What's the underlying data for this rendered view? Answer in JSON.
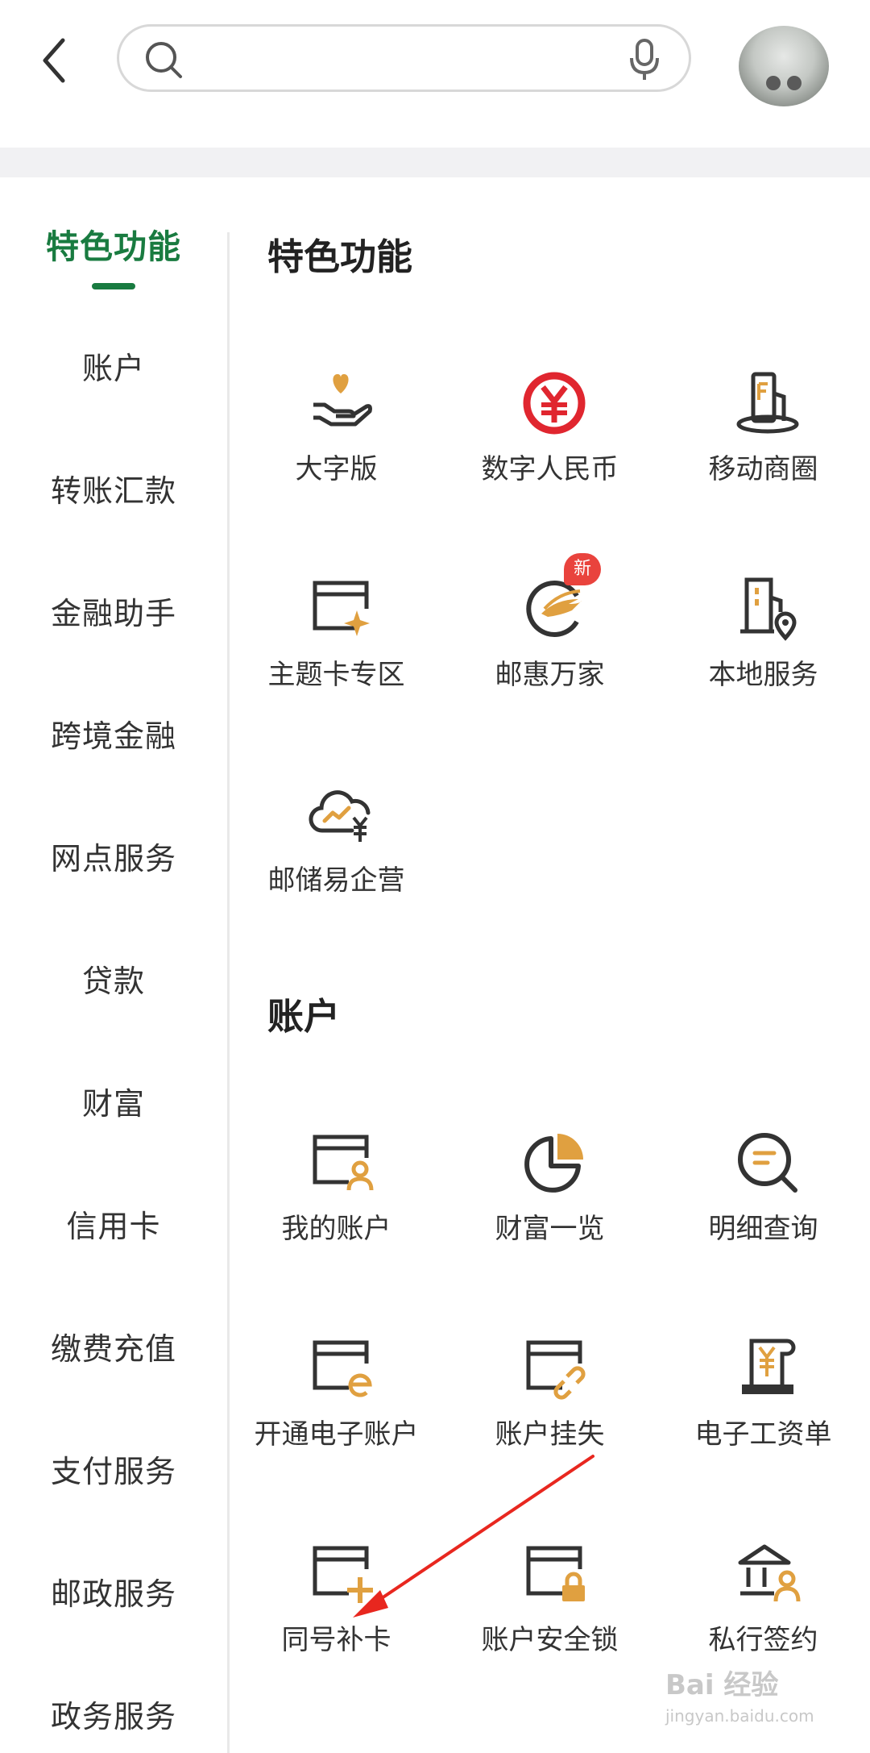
{
  "search": {
    "value": "",
    "placeholder": ""
  },
  "sidebar": {
    "items": [
      {
        "label": "特色功能"
      },
      {
        "label": "账户"
      },
      {
        "label": "转账汇款"
      },
      {
        "label": "金融助手"
      },
      {
        "label": "跨境金融"
      },
      {
        "label": "网点服务"
      },
      {
        "label": "贷款"
      },
      {
        "label": "财富"
      },
      {
        "label": "信用卡"
      },
      {
        "label": "缴费充值"
      },
      {
        "label": "支付服务"
      },
      {
        "label": "邮政服务"
      },
      {
        "label": "政务服务"
      }
    ]
  },
  "sections": [
    {
      "title": "特色功能",
      "items": [
        {
          "label": "大字版",
          "icon": "hand-heart-icon"
        },
        {
          "label": "数字人民币",
          "icon": "digital-rmb-icon"
        },
        {
          "label": "移动商圈",
          "icon": "mobile-mall-icon"
        },
        {
          "label": "主题卡专区",
          "icon": "theme-card-icon"
        },
        {
          "label": "邮惠万家",
          "icon": "postal-benefit-icon",
          "badge": "新"
        },
        {
          "label": "本地服务",
          "icon": "local-service-icon"
        },
        {
          "label": "邮储易企营",
          "icon": "cloud-enterprise-icon"
        }
      ]
    },
    {
      "title": "账户",
      "items": [
        {
          "label": "我的账户",
          "icon": "my-account-icon"
        },
        {
          "label": "财富一览",
          "icon": "pie-chart-icon"
        },
        {
          "label": "明细查询",
          "icon": "detail-search-icon"
        },
        {
          "label": "开通电子账户",
          "icon": "e-account-icon"
        },
        {
          "label": "账户挂失",
          "icon": "report-loss-icon"
        },
        {
          "label": "电子工资单",
          "icon": "payslip-icon"
        },
        {
          "label": "同号补卡",
          "icon": "card-replace-icon"
        },
        {
          "label": "账户安全锁",
          "icon": "account-lock-icon"
        },
        {
          "label": "私行签约",
          "icon": "private-bank-icon"
        }
      ]
    }
  ],
  "watermark": {
    "brand": "Bai 经验",
    "url": "jingyan.baidu.com"
  },
  "colors": {
    "accent": "#197b40",
    "icon_dark": "#333333",
    "icon_gold": "#e0a040",
    "badge": "#e9433d",
    "rmb_red": "#e0262f"
  }
}
